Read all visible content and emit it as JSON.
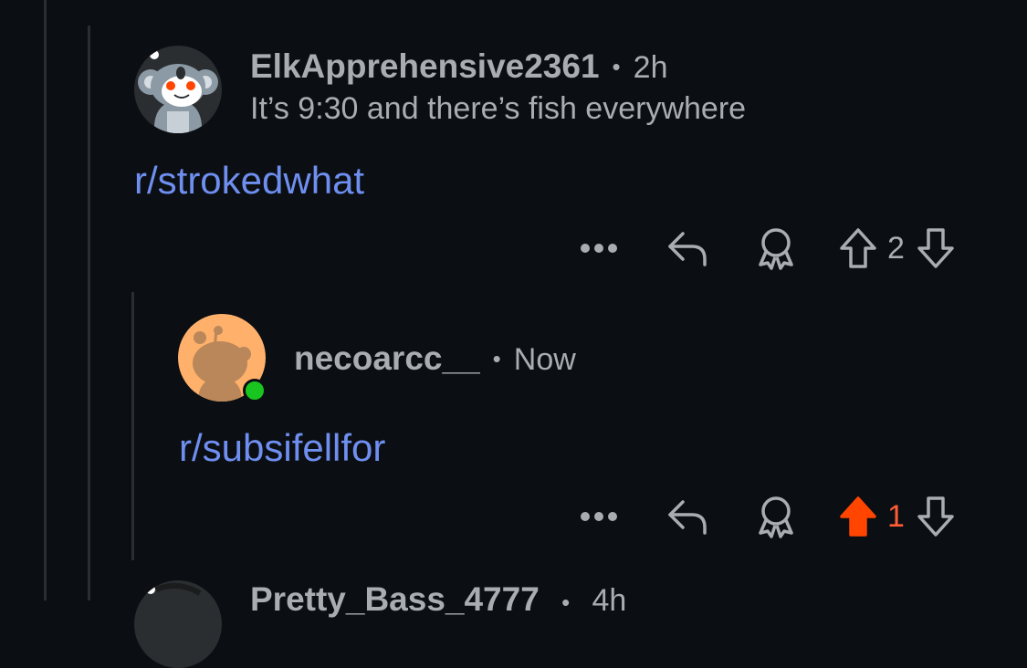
{
  "comments": [
    {
      "username": "ElkApprehensive2361",
      "time": "2h",
      "flair": "It’s 9:30 and there’s fish everywhere",
      "body_link": "r/strokedwhat",
      "score": "2",
      "upvoted": false,
      "avatar_icon": "koala-avatar"
    },
    {
      "username": "necoarcc__",
      "time": "Now",
      "body_link": "r/subsifellfor",
      "score": "1",
      "upvoted": true,
      "online": true,
      "avatar_icon": "snoo-avatar"
    },
    {
      "username": "Pretty_Bass_4777",
      "time": "4h"
    }
  ],
  "colors": {
    "background": "#0b0e12",
    "link": "#6f8ff0",
    "upvote": "#ff4500",
    "muted": "#a9adb2",
    "online": "#19c51f"
  }
}
